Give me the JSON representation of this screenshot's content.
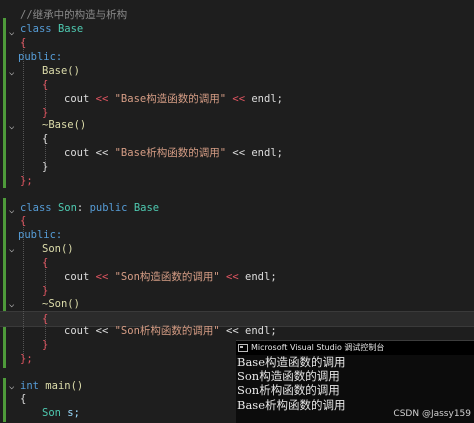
{
  "code": {
    "comment": "//继承中的构造与析构",
    "kw_class": "class",
    "kw_public": "public:",
    "kw_public_plain": "public",
    "base_name": "Base",
    "son_name": "Son",
    "base_ctor": "Base()",
    "base_dtor": "~Base()",
    "son_ctor": "Son()",
    "son_dtor": "~Son()",
    "cout": "cout",
    "op": "<<",
    "endl": "endl;",
    "str_base_ctor": "\"Base构造函数的调用\"",
    "str_base_dtor": "\"Base析构函数的调用\"",
    "str_son_ctor": "\"Son构造函数的调用\"",
    "str_son_dtor": "\"Son析构函数的调用\"",
    "open_brace": "{",
    "close_brace": "}",
    "close_class": "};",
    "kw_int": "int",
    "main": "main()",
    "son_decl_type": "Son",
    "son_decl_var": "s;",
    "colon": ":"
  },
  "console": {
    "title": "Microsoft Visual Studio 调试控制台",
    "lines": [
      "Base构造函数的调用",
      "Son构造函数的调用",
      "Son析构函数的调用",
      "Base析构函数的调用"
    ]
  },
  "watermark": "CSDN @Jassy159",
  "colors": {
    "keyword": "#569cd6",
    "type": "#4ec9b0",
    "function": "#dcdcaa",
    "string": "#d69d85",
    "brace_match": "#e05561",
    "change_bar": "#4e9a3a",
    "background": "#1e1e1e"
  }
}
